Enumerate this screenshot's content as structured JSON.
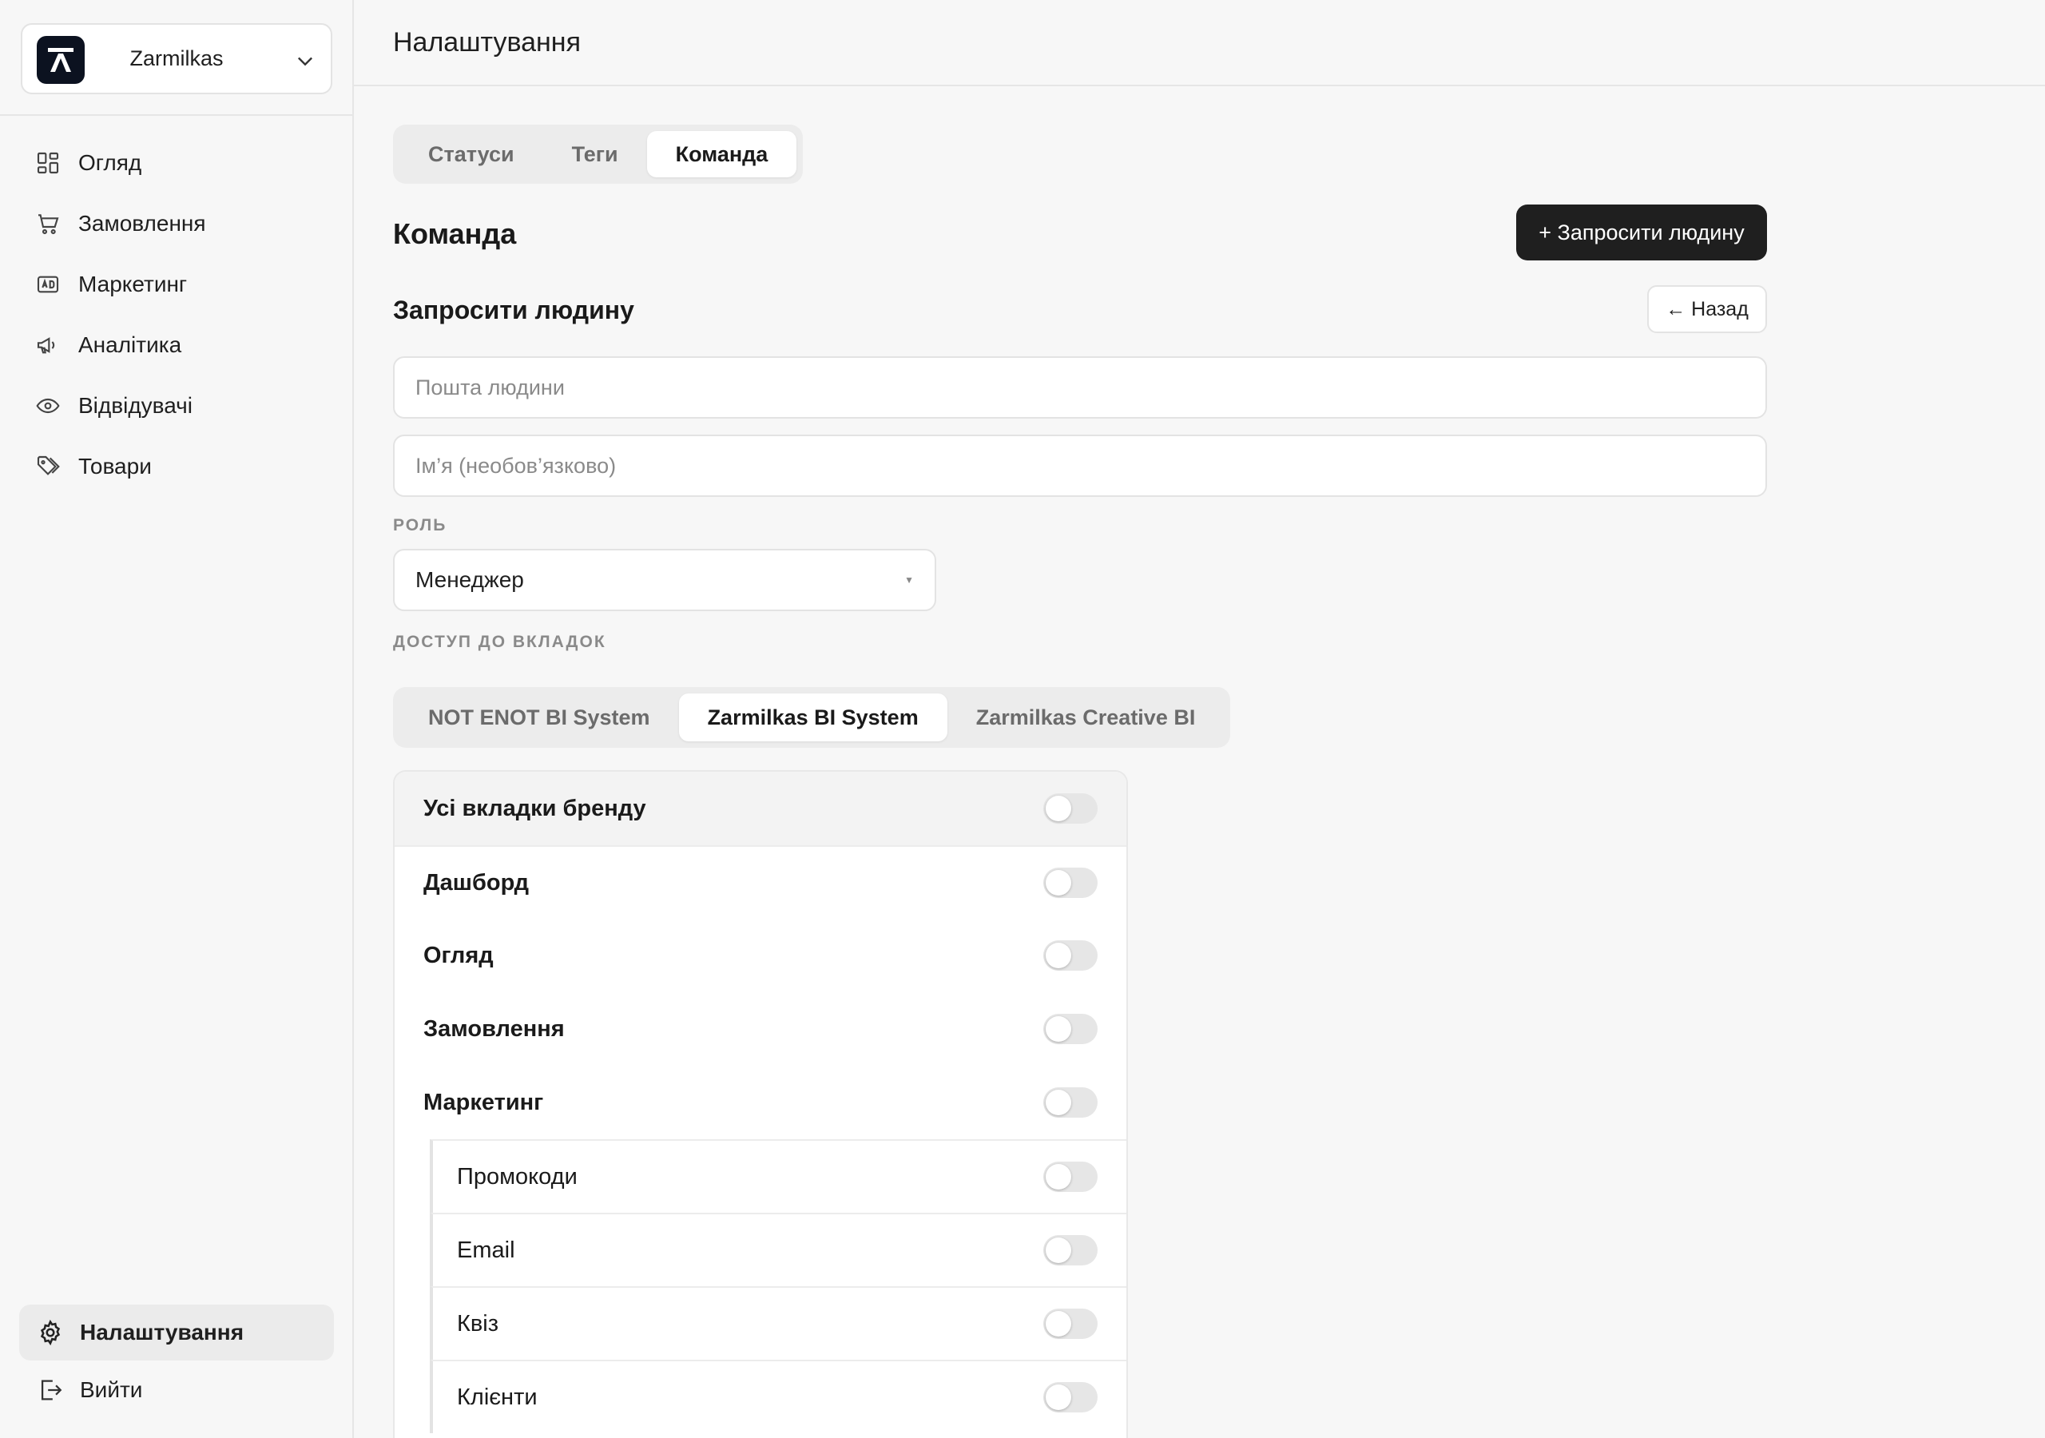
{
  "sidebar": {
    "brand": {
      "name": "Zarmilkas"
    },
    "items": [
      {
        "label": "Огляд",
        "icon": "grid-icon"
      },
      {
        "label": "Замовлення",
        "icon": "cart-icon"
      },
      {
        "label": "Маркетинг",
        "icon": "ad-icon"
      },
      {
        "label": "Аналітика",
        "icon": "megaphone-icon"
      },
      {
        "label": "Відвідувачі",
        "icon": "eye-icon"
      },
      {
        "label": "Товари",
        "icon": "tag-icon"
      }
    ],
    "settings_label": "Налаштування",
    "logout_label": "Вийти"
  },
  "header": {
    "title": "Налаштування"
  },
  "tabs": [
    {
      "label": "Статуси",
      "active": false
    },
    {
      "label": "Теги",
      "active": false
    },
    {
      "label": "Команда",
      "active": true
    }
  ],
  "team": {
    "title": "Команда",
    "invite_button": "+ Запросити людину",
    "invite_title": "Запросити людину",
    "back_button": "← Назад",
    "email_placeholder": "Пошта людини",
    "name_placeholder": "Ім’я (необов’язково)",
    "role_label": "РОЛЬ",
    "role_value": "Менеджер",
    "access_label": "ДОСТУП ДО ВКЛАДОК"
  },
  "brand_tabs": [
    {
      "label": "NOT ENOT BI System",
      "active": false
    },
    {
      "label": "Zarmilkas BI System",
      "active": true
    },
    {
      "label": "Zarmilkas Creative BI",
      "active": false
    }
  ],
  "access": {
    "all_label": "Усі вкладки бренду",
    "rows": [
      {
        "label": "Дашборд",
        "enabled": false
      },
      {
        "label": "Огляд",
        "enabled": false
      },
      {
        "label": "Замовлення",
        "enabled": false
      },
      {
        "label": "Маркетинг",
        "enabled": false
      }
    ],
    "children": [
      {
        "label": "Промокоди",
        "enabled": false
      },
      {
        "label": "Email",
        "enabled": false
      },
      {
        "label": "Квіз",
        "enabled": false
      },
      {
        "label": "Клієнти",
        "enabled": false
      }
    ]
  },
  "colors": {
    "primary": "#1f1f1f",
    "background": "#f7f7f7",
    "logo_bg": "#0c1220"
  }
}
